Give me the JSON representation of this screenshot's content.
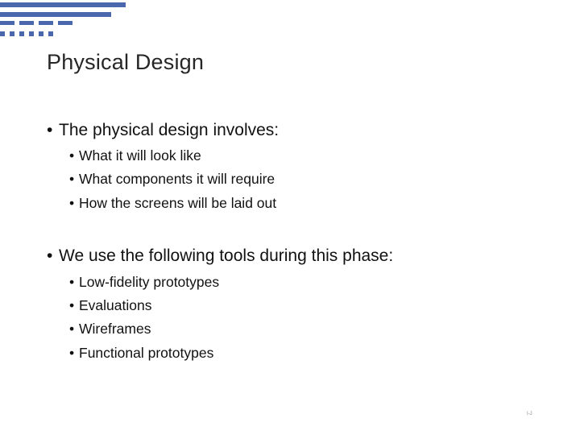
{
  "slide": {
    "title": "Physical Design",
    "accent_color": "#4a67ad",
    "bullet_glyph": "•",
    "sections": [
      {
        "text": "The physical design involves:",
        "items": [
          "What it will look like",
          "What components it will require",
          "How the screens will be laid out"
        ]
      },
      {
        "text": "We use the following tools during this phase:",
        "items": [
          "Low-fidelity prototypes",
          "Evaluations",
          "Wireframes",
          "Functional prototypes"
        ]
      }
    ],
    "page_number": "I-J"
  }
}
